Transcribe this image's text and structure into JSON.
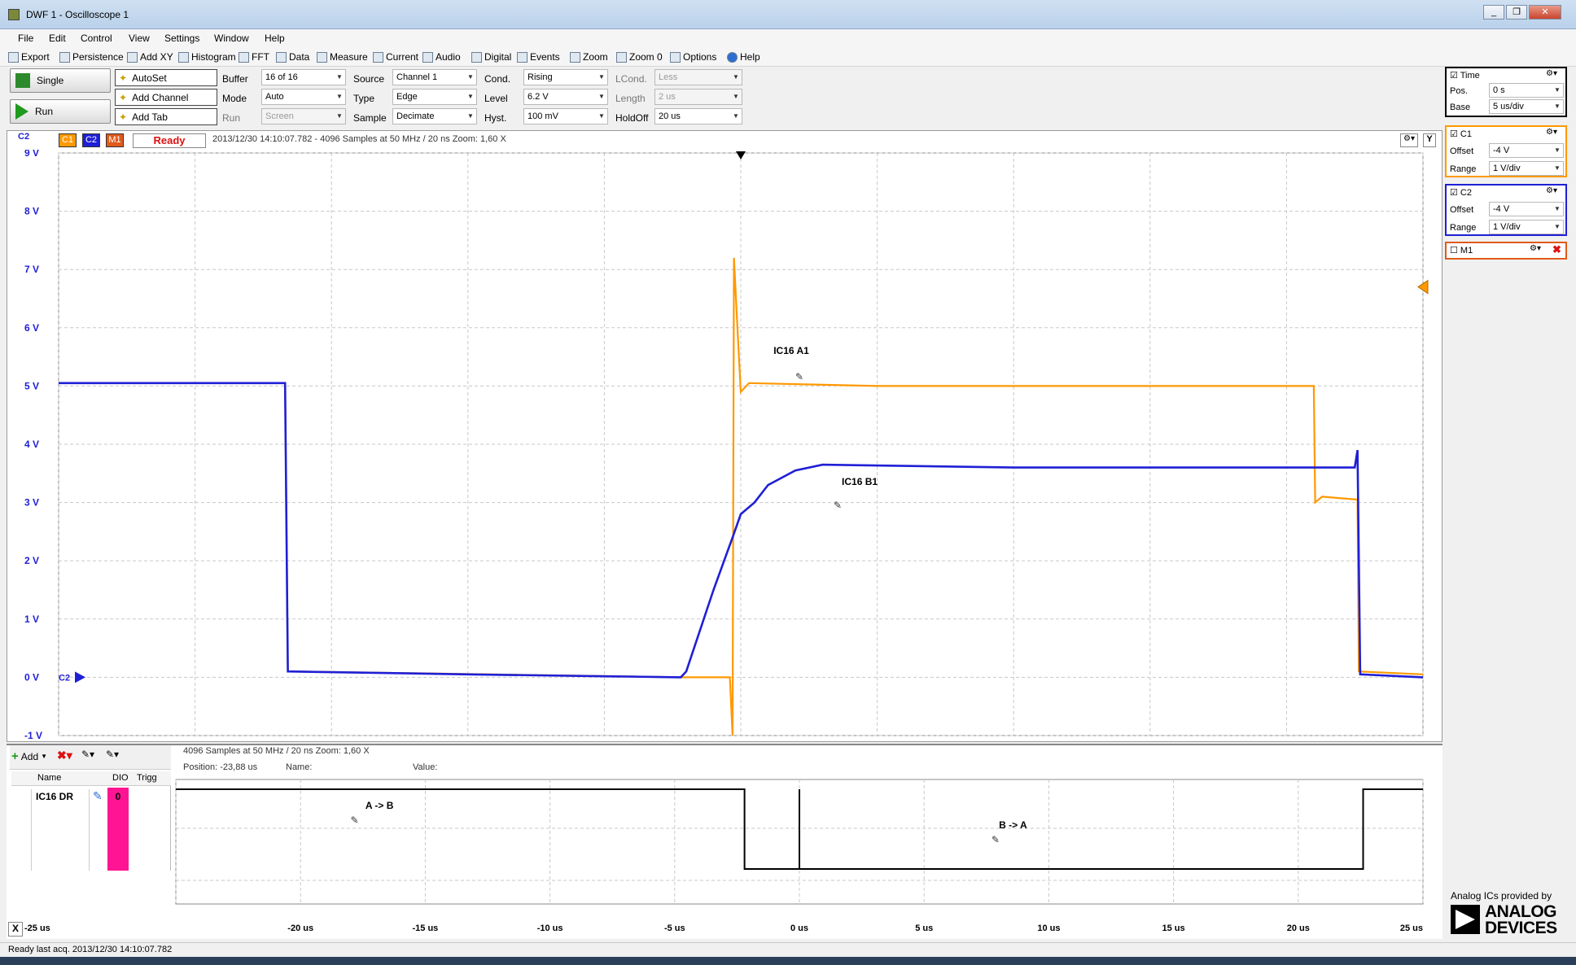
{
  "window": {
    "title": "DWF 1 - Oscilloscope 1"
  },
  "menu": [
    "File",
    "Edit",
    "Control",
    "View",
    "Settings",
    "Window",
    "Help"
  ],
  "toolbar": [
    "Export",
    "Persistence",
    "Add XY",
    "Histogram",
    "FFT",
    "Data",
    "Measure",
    "Current",
    "Audio",
    "Digital",
    "Events",
    "Zoom",
    "Zoom 0",
    "Options",
    "Help"
  ],
  "controls": {
    "single": "Single",
    "run": "Run",
    "autoset": "AutoSet",
    "add_channel": "Add Channel",
    "add_tab": "Add Tab",
    "buffer_label": "Buffer",
    "buffer_value": "16 of 16",
    "mode_label": "Mode",
    "mode_value": "Auto",
    "run_label": "Run",
    "run_value": "Screen",
    "source_label": "Source",
    "source_value": "Channel 1",
    "type_label": "Type",
    "type_value": "Edge",
    "sample_label": "Sample",
    "sample_value": "Decimate",
    "cond_label": "Cond.",
    "cond_value": "Rising",
    "level_label": "Level",
    "level_value": "6.2 V",
    "hyst_label": "Hyst.",
    "hyst_value": "100 mV",
    "lcond_label": "LCond.",
    "lcond_value": "Less",
    "length_label": "Length",
    "length_value": "2 us",
    "holdoff_label": "HoldOff",
    "holdoff_value": "20 us"
  },
  "status": {
    "channel_label": "C2",
    "c1": "C1",
    "c2": "C2",
    "m1": "M1",
    "ready": "Ready",
    "info": "2013/12/30  14:10:07.782 - 4096 Samples at 50 MHz / 20 ns Zoom: 1,60 X",
    "y_button": "Y"
  },
  "right_panel": {
    "time": {
      "title": "Time",
      "pos_label": "Pos.",
      "pos_value": "0 s",
      "base_label": "Base",
      "base_value": "5 us/div"
    },
    "c1": {
      "title": "C1",
      "offset_label": "Offset",
      "offset_value": "-4 V",
      "range_label": "Range",
      "range_value": "1 V/div"
    },
    "c2": {
      "title": "C2",
      "offset_label": "Offset",
      "offset_value": "-4 V",
      "range_label": "Range",
      "range_value": "1 V/div"
    },
    "m1": {
      "title": "M1"
    },
    "brand_line": "Analog ICs provided by",
    "brand1": "ANALOG",
    "brand2": "DEVICES"
  },
  "logic": {
    "add": "Add",
    "col_name": "Name",
    "col_dio": "DIO",
    "col_trigg": "Trigg",
    "channel_name": "IC16 DR",
    "channel_dio": "0",
    "info": "4096 Samples at 50 MHz / 20 ns Zoom: 1,60 X",
    "position": "Position: -23,88 us",
    "name_label": "Name:",
    "value_label": "Value:",
    "label_ab": "A -> B",
    "label_ba": "B -> A",
    "x_button": "X"
  },
  "bottom_status": "Ready last acq. 2013/12/30 14:10:07.782",
  "colors": {
    "c1": "#ff9900",
    "c2": "#1f1fd6",
    "m1": "#e05a1a",
    "dio": "#ff1493"
  },
  "chart_data": {
    "type": "line",
    "ylabels": [
      "9 V",
      "8 V",
      "7 V",
      "6 V",
      "5 V",
      "4 V",
      "3 V",
      "2 V",
      "1 V",
      "0 V",
      "-1 V"
    ],
    "yrange": [
      -1,
      9
    ],
    "xlabels": [
      "-25 us",
      "-20 us",
      "-15 us",
      "-10 us",
      "-5 us",
      "0 us",
      "5 us",
      "10 us",
      "15 us",
      "20 us",
      "25 us"
    ],
    "xrange": [
      -25,
      25
    ],
    "series": [
      {
        "name": "C1",
        "color": "#ff9900",
        "points": [
          [
            -25,
            5.05
          ],
          [
            -16.7,
            5.05
          ],
          [
            -16.6,
            0.1
          ],
          [
            -16.3,
            0.1
          ],
          [
            -2.2,
            0.0
          ],
          [
            -0.4,
            0.0
          ],
          [
            -0.3,
            -1
          ],
          [
            -0.25,
            7.2
          ],
          [
            -0.1,
            5.8
          ],
          [
            0,
            4.9
          ],
          [
            0.3,
            5.05
          ],
          [
            5,
            5.0
          ],
          [
            15,
            5.0
          ],
          [
            21,
            5.0
          ],
          [
            21.05,
            3.0
          ],
          [
            21.3,
            3.1
          ],
          [
            22.6,
            3.05
          ],
          [
            22.65,
            0.1
          ],
          [
            25,
            0.05
          ]
        ]
      },
      {
        "name": "C2",
        "color": "#1f1fd6",
        "points": [
          [
            -25,
            5.05
          ],
          [
            -16.7,
            5.05
          ],
          [
            -16.6,
            0.1
          ],
          [
            -10,
            0.05
          ],
          [
            -2.2,
            0.0
          ],
          [
            -2,
            0.1
          ],
          [
            -1,
            1.5
          ],
          [
            -0.3,
            2.4
          ],
          [
            0,
            2.8
          ],
          [
            0.5,
            3.0
          ],
          [
            1,
            3.3
          ],
          [
            2,
            3.55
          ],
          [
            3,
            3.65
          ],
          [
            10,
            3.6
          ],
          [
            20,
            3.6
          ],
          [
            22.5,
            3.6
          ],
          [
            22.6,
            3.9
          ],
          [
            22.7,
            0.05
          ],
          [
            25,
            0.0
          ]
        ]
      }
    ],
    "annotations": [
      "IC16 A1",
      "IC16 B1"
    ],
    "logic_series": {
      "name": "IC16 DR",
      "points": [
        [
          -25,
          1
        ],
        [
          -2.2,
          1
        ],
        [
          -2.2,
          0
        ],
        [
          0,
          0
        ],
        [
          0,
          1
        ],
        [
          0,
          0
        ],
        [
          22.6,
          0
        ],
        [
          22.6,
          1
        ],
        [
          25,
          1
        ]
      ]
    }
  }
}
